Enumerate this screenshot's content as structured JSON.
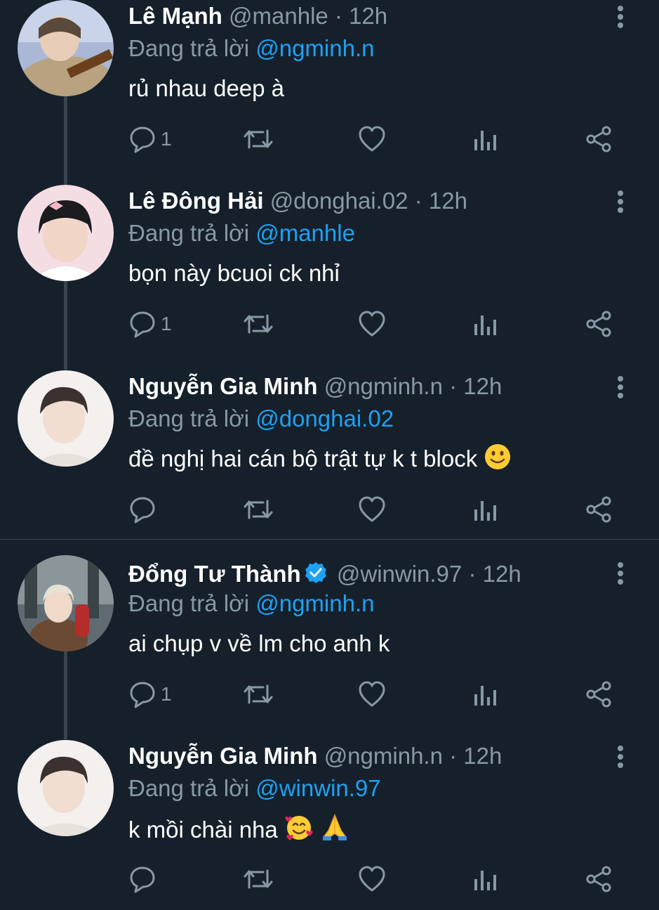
{
  "reply_prefix": "Đang trả lời",
  "tweets": [
    {
      "name": "Lê Mạnh",
      "handle": "@manhle",
      "time": "12h",
      "reply_to": "@ngminh.n",
      "text": "rủ nhau deep à",
      "reply_count": "1"
    },
    {
      "name": "Lê Đông Hải",
      "handle": "@donghai.02",
      "time": "12h",
      "reply_to": "@manhle",
      "text": "bọn này bcuoi ck nhỉ",
      "reply_count": "1"
    },
    {
      "name": "Nguyễn Gia Minh",
      "handle": "@ngminh.n",
      "time": "12h",
      "reply_to": "@donghai.02",
      "text": "đề nghị hai cán bộ trật tự k t block",
      "reply_count": ""
    },
    {
      "name": "Đổng Tư Thành",
      "handle": "@winwin.97",
      "time": "12h",
      "reply_to": "@ngminh.n",
      "text": "ai chụp v về lm cho anh k",
      "reply_count": "1",
      "verified": true
    },
    {
      "name": "Nguyễn Gia Minh",
      "handle": "@ngminh.n",
      "time": "12h",
      "reply_to": "@winwin.97",
      "text": "k mồi chài nha",
      "reply_count": ""
    }
  ],
  "separator": "·",
  "icons": [
    "reply-icon",
    "retweet-icon",
    "like-icon",
    "analytics-icon",
    "share-icon",
    "more-options-icon",
    "verified-badge-icon"
  ],
  "colors": {
    "background": "#15202b",
    "secondary_text": "#8899a6",
    "link": "#1da1f2",
    "thread_line": "#38444d"
  }
}
